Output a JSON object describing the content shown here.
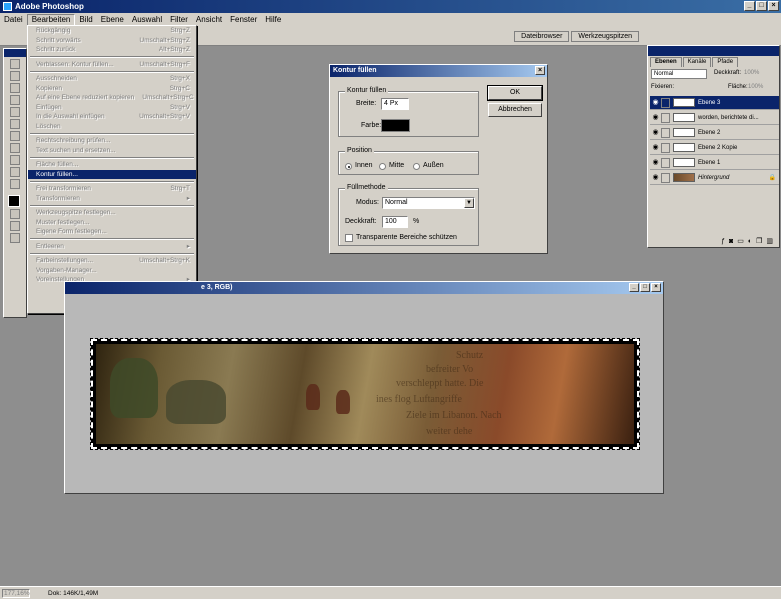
{
  "app": {
    "title": "Adobe Photoshop",
    "window_buttons": [
      "_",
      "□",
      "×"
    ]
  },
  "menubar": {
    "items": [
      "Datei",
      "Bearbeiten",
      "Bild",
      "Ebene",
      "Auswahl",
      "Filter",
      "Ansicht",
      "Fenster",
      "Hilfe"
    ],
    "active_index": 1
  },
  "palette_well": {
    "tabs": [
      "Dateibrowser",
      "Werkzeugspitzen"
    ]
  },
  "edit_menu": {
    "items": [
      {
        "label": "Rückgängig",
        "shortcut": "Strg+Z",
        "enabled": false
      },
      {
        "label": "Schritt vorwärts",
        "shortcut": "Umschalt+Strg+Z",
        "enabled": false
      },
      {
        "label": "Schritt zurück",
        "shortcut": "Alt+Strg+Z",
        "enabled": false
      },
      {
        "sep": true
      },
      {
        "label": "Verblassen: Kontur füllen...",
        "shortcut": "Umschalt+Strg+F",
        "enabled": false
      },
      {
        "sep": true
      },
      {
        "label": "Ausschneiden",
        "shortcut": "Strg+X",
        "enabled": false
      },
      {
        "label": "Kopieren",
        "shortcut": "Strg+C",
        "enabled": false
      },
      {
        "label": "Auf eine Ebene reduziert kopieren",
        "shortcut": "Umschalt+Strg+C",
        "enabled": false
      },
      {
        "label": "Einfügen",
        "shortcut": "Strg+V",
        "enabled": false
      },
      {
        "label": "In die Auswahl einfügen",
        "shortcut": "Umschalt+Strg+V",
        "enabled": false
      },
      {
        "label": "Löschen",
        "shortcut": "",
        "enabled": false
      },
      {
        "sep": true
      },
      {
        "label": "Rechtschreibung prüfen...",
        "shortcut": "",
        "enabled": false
      },
      {
        "label": "Text suchen und ersetzen...",
        "shortcut": "",
        "enabled": false
      },
      {
        "sep": true
      },
      {
        "label": "Fläche füllen...",
        "shortcut": "",
        "enabled": false
      },
      {
        "label": "Kontur füllen...",
        "shortcut": "",
        "enabled": true,
        "highlight": true
      },
      {
        "sep": true
      },
      {
        "label": "Frei transformieren",
        "shortcut": "Strg+T",
        "enabled": false
      },
      {
        "label": "Transformieren",
        "shortcut": "▸",
        "enabled": false
      },
      {
        "sep": true
      },
      {
        "label": "Werkzeugspitze festlegen...",
        "shortcut": "",
        "enabled": false
      },
      {
        "label": "Muster festlegen...",
        "shortcut": "",
        "enabled": false
      },
      {
        "label": "Eigene Form festlegen...",
        "shortcut": "",
        "enabled": false
      },
      {
        "sep": true
      },
      {
        "label": "Entleeren",
        "shortcut": "▸",
        "enabled": false
      },
      {
        "sep": true
      },
      {
        "label": "Farbeinstellungen...",
        "shortcut": "Umschalt+Strg+K",
        "enabled": false
      },
      {
        "label": "Vorgaben-Manager...",
        "shortcut": "",
        "enabled": false
      },
      {
        "label": "Voreinstellungen",
        "shortcut": "▸",
        "enabled": false
      }
    ]
  },
  "dialog": {
    "title": "Kontur füllen",
    "close": "×",
    "stroke_group": "Kontur füllen",
    "width_label": "Breite:",
    "width_value": "4 Px",
    "color_label": "Farbe:",
    "stroke_color": "#000000",
    "position_group": "Position",
    "positions": [
      "Innen",
      "Mitte",
      "Außen"
    ],
    "position_selected": 0,
    "blend_group": "Füllmethode",
    "mode_label": "Modus:",
    "mode_value": "Normal",
    "opacity_label": "Deckkraft:",
    "opacity_value": "100",
    "opacity_unit": "%",
    "preserve_label": "Transparente Bereiche schützen",
    "preserve_checked": false,
    "ok_label": "OK",
    "cancel_label": "Abbrechen"
  },
  "document": {
    "title_visible": "e 3, RGB)",
    "banner_lines": [
      "Schutz",
      "befreiter Vo",
      "verschleppt hatte. Die",
      "ines flog Luftangriffe",
      "Ziele im Libanon. Nach",
      "weiter dehe"
    ]
  },
  "layers_panel": {
    "tabs": [
      "Ebenen",
      "Kanäle",
      "Pfade"
    ],
    "active_tab": 0,
    "blend_mode": "Normal",
    "opacity_label": "Deckkraft:",
    "opacity_value": "100%",
    "lock_label": "Fixieren:",
    "fill_label": "Fläche:",
    "fill_value": "100%",
    "layers": [
      {
        "name": "Ebene 3",
        "selected": true
      },
      {
        "name": "worden, berichtete di...",
        "selected": false
      },
      {
        "name": "Ebene 2",
        "selected": false
      },
      {
        "name": "Ebene 2 Kopie",
        "selected": false
      },
      {
        "name": "Ebene 1",
        "selected": false
      },
      {
        "name": "Hintergrund",
        "selected": false,
        "background": true
      }
    ]
  },
  "statusbar": {
    "zoom": "177,16%",
    "doc_info": "Dok: 146K/1,49M"
  },
  "colors": {
    "titlebar": "#0a246a",
    "chrome": "#d4d0c8",
    "workspace": "#8e8e8e"
  }
}
